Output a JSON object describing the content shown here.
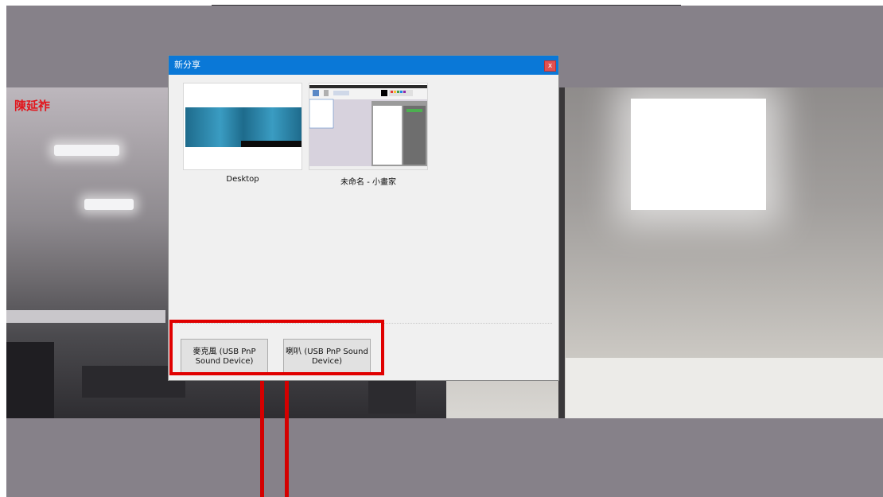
{
  "remote_video": {
    "participant_name": "陳延祚"
  },
  "dialog": {
    "title": "新分享",
    "close_label": "x",
    "share_sources": [
      {
        "label": "Desktop"
      },
      {
        "label": "未命名 - 小畫家"
      }
    ],
    "audio_devices": [
      {
        "label": "麥克風 (USB PnP Sound Device)"
      },
      {
        "label": "喇叭 (USB PnP Sound Device)"
      }
    ]
  },
  "colors": {
    "title_bar": "#0a78d7",
    "highlight": "#e00000",
    "name_label": "#e1161d",
    "background": "#868189"
  }
}
